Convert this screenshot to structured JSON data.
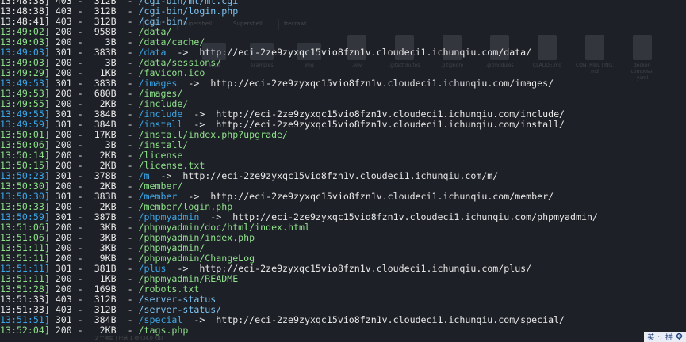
{
  "terminal": {
    "lines": [
      {
        "ts": "13:48:38]",
        "code": "403",
        "size": "312B",
        "path": "/cgi-bin/mt/mt.cgi",
        "target": ""
      },
      {
        "ts": "13:48:38]",
        "code": "403",
        "size": "312B",
        "path": "/cgi-bin/login.php",
        "target": ""
      },
      {
        "ts": "13:48:41]",
        "code": "403",
        "size": "312B",
        "path": "/cgi-bin/",
        "target": ""
      },
      {
        "ts": "13:49:02]",
        "code": "200",
        "size": "958B",
        "path": "/data/",
        "target": ""
      },
      {
        "ts": "13:49:03]",
        "code": "200",
        "size": "3B",
        "path": "/data/cache/",
        "target": ""
      },
      {
        "ts": "13:49:03]",
        "code": "301",
        "size": "383B",
        "path": "/data",
        "target": "http://eci-2ze9zyxqc15vio8fzn1v.cloudeci1.ichunqiu.com/data/"
      },
      {
        "ts": "13:49:03]",
        "code": "200",
        "size": "3B",
        "path": "/data/sessions/",
        "target": ""
      },
      {
        "ts": "13:49:29]",
        "code": "200",
        "size": "1KB",
        "path": "/favicon.ico",
        "target": ""
      },
      {
        "ts": "13:49:53]",
        "code": "301",
        "size": "383B",
        "path": "/images",
        "target": "http://eci-2ze9zyxqc15vio8fzn1v.cloudeci1.ichunqiu.com/images/"
      },
      {
        "ts": "13:49:53]",
        "code": "200",
        "size": "680B",
        "path": "/images/",
        "target": ""
      },
      {
        "ts": "13:49:55]",
        "code": "200",
        "size": "2KB",
        "path": "/include/",
        "target": ""
      },
      {
        "ts": "13:49:55]",
        "code": "301",
        "size": "384B",
        "path": "/include",
        "target": "http://eci-2ze9zyxqc15vio8fzn1v.cloudeci1.ichunqiu.com/include/"
      },
      {
        "ts": "13:49:59]",
        "code": "301",
        "size": "384B",
        "path": "/install",
        "target": "http://eci-2ze9zyxqc15vio8fzn1v.cloudeci1.ichunqiu.com/install/"
      },
      {
        "ts": "13:50:01]",
        "code": "200",
        "size": "17KB",
        "path": "/install/index.php?upgrade/",
        "target": ""
      },
      {
        "ts": "13:50:06]",
        "code": "200",
        "size": "3B",
        "path": "/install/",
        "target": ""
      },
      {
        "ts": "13:50:14]",
        "code": "200",
        "size": "2KB",
        "path": "/license",
        "target": ""
      },
      {
        "ts": "13:50:15]",
        "code": "200",
        "size": "2KB",
        "path": "/license.txt",
        "target": ""
      },
      {
        "ts": "13:50:23]",
        "code": "301",
        "size": "378B",
        "path": "/m",
        "target": "http://eci-2ze9zyxqc15vio8fzn1v.cloudeci1.ichunqiu.com/m/"
      },
      {
        "ts": "13:50:30]",
        "code": "200",
        "size": "2KB",
        "path": "/member/",
        "target": ""
      },
      {
        "ts": "13:50:30]",
        "code": "301",
        "size": "383B",
        "path": "/member",
        "target": "http://eci-2ze9zyxqc15vio8fzn1v.cloudeci1.ichunqiu.com/member/"
      },
      {
        "ts": "13:50:33]",
        "code": "200",
        "size": "2KB",
        "path": "/member/login.php",
        "target": ""
      },
      {
        "ts": "13:50:59]",
        "code": "301",
        "size": "387B",
        "path": "/phpmyadmin",
        "target": "http://eci-2ze9zyxqc15vio8fzn1v.cloudeci1.ichunqiu.com/phpmyadmin/"
      },
      {
        "ts": "13:51:06]",
        "code": "200",
        "size": "3KB",
        "path": "/phpmyadmin/doc/html/index.html",
        "target": ""
      },
      {
        "ts": "13:51:06]",
        "code": "200",
        "size": "3KB",
        "path": "/phpmyadmin/index.php",
        "target": ""
      },
      {
        "ts": "13:51:11]",
        "code": "200",
        "size": "3KB",
        "path": "/phpmyadmin/",
        "target": ""
      },
      {
        "ts": "13:51:11]",
        "code": "200",
        "size": "9KB",
        "path": "/phpmyadmin/ChangeLog",
        "target": ""
      },
      {
        "ts": "13:51:11]",
        "code": "301",
        "size": "381B",
        "path": "/plus",
        "target": "http://eci-2ze9zyxqc15vio8fzn1v.cloudeci1.ichunqiu.com/plus/"
      },
      {
        "ts": "13:51:11]",
        "code": "200",
        "size": "1KB",
        "path": "/phpmyadmin/README",
        "target": ""
      },
      {
        "ts": "13:51:28]",
        "code": "200",
        "size": "169B",
        "path": "/robots.txt",
        "target": ""
      },
      {
        "ts": "13:51:33]",
        "code": "403",
        "size": "312B",
        "path": "/server-status",
        "target": ""
      },
      {
        "ts": "13:51:33]",
        "code": "403",
        "size": "312B",
        "path": "/server-status/",
        "target": ""
      },
      {
        "ts": "13:51:51]",
        "code": "301",
        "size": "384B",
        "path": "/special",
        "target": "http://eci-2ze9zyxqc15vio8fzn1v.cloudeci1.ichunqiu.com/special/"
      },
      {
        "ts": "13:52:04]",
        "code": "200",
        "size": "2KB",
        "path": "/tags.php",
        "target": ""
      }
    ]
  },
  "background": {
    "tabs": [
      "shell",
      "Supershell",
      "Supershell",
      "frecrawl"
    ],
    "files": [
      {
        "name": "apps",
        "kind": "folder"
      },
      {
        "name": "examples",
        "kind": "folder"
      },
      {
        "name": "img",
        "kind": "folder"
      },
      {
        "name": ".env",
        "kind": "file"
      },
      {
        "name": ".gitattributes",
        "kind": "file"
      },
      {
        "name": ".gitignore",
        "kind": "file"
      },
      {
        "name": ".gitmodules",
        "kind": "file"
      },
      {
        "name": "CLAUDE.md",
        "kind": "file"
      },
      {
        "name": "CONTRIBUTING.\nmd",
        "kind": "file"
      },
      {
        "name": "docker-compose.\nyaml",
        "kind": "file"
      }
    ],
    "footer": "2 个项目  |  已选 1 项 (34.0 KB)"
  },
  "ime": {
    "lang": "英",
    "punct": "·,",
    "mode": "拼",
    "settings_icon": "gear-icon"
  }
}
